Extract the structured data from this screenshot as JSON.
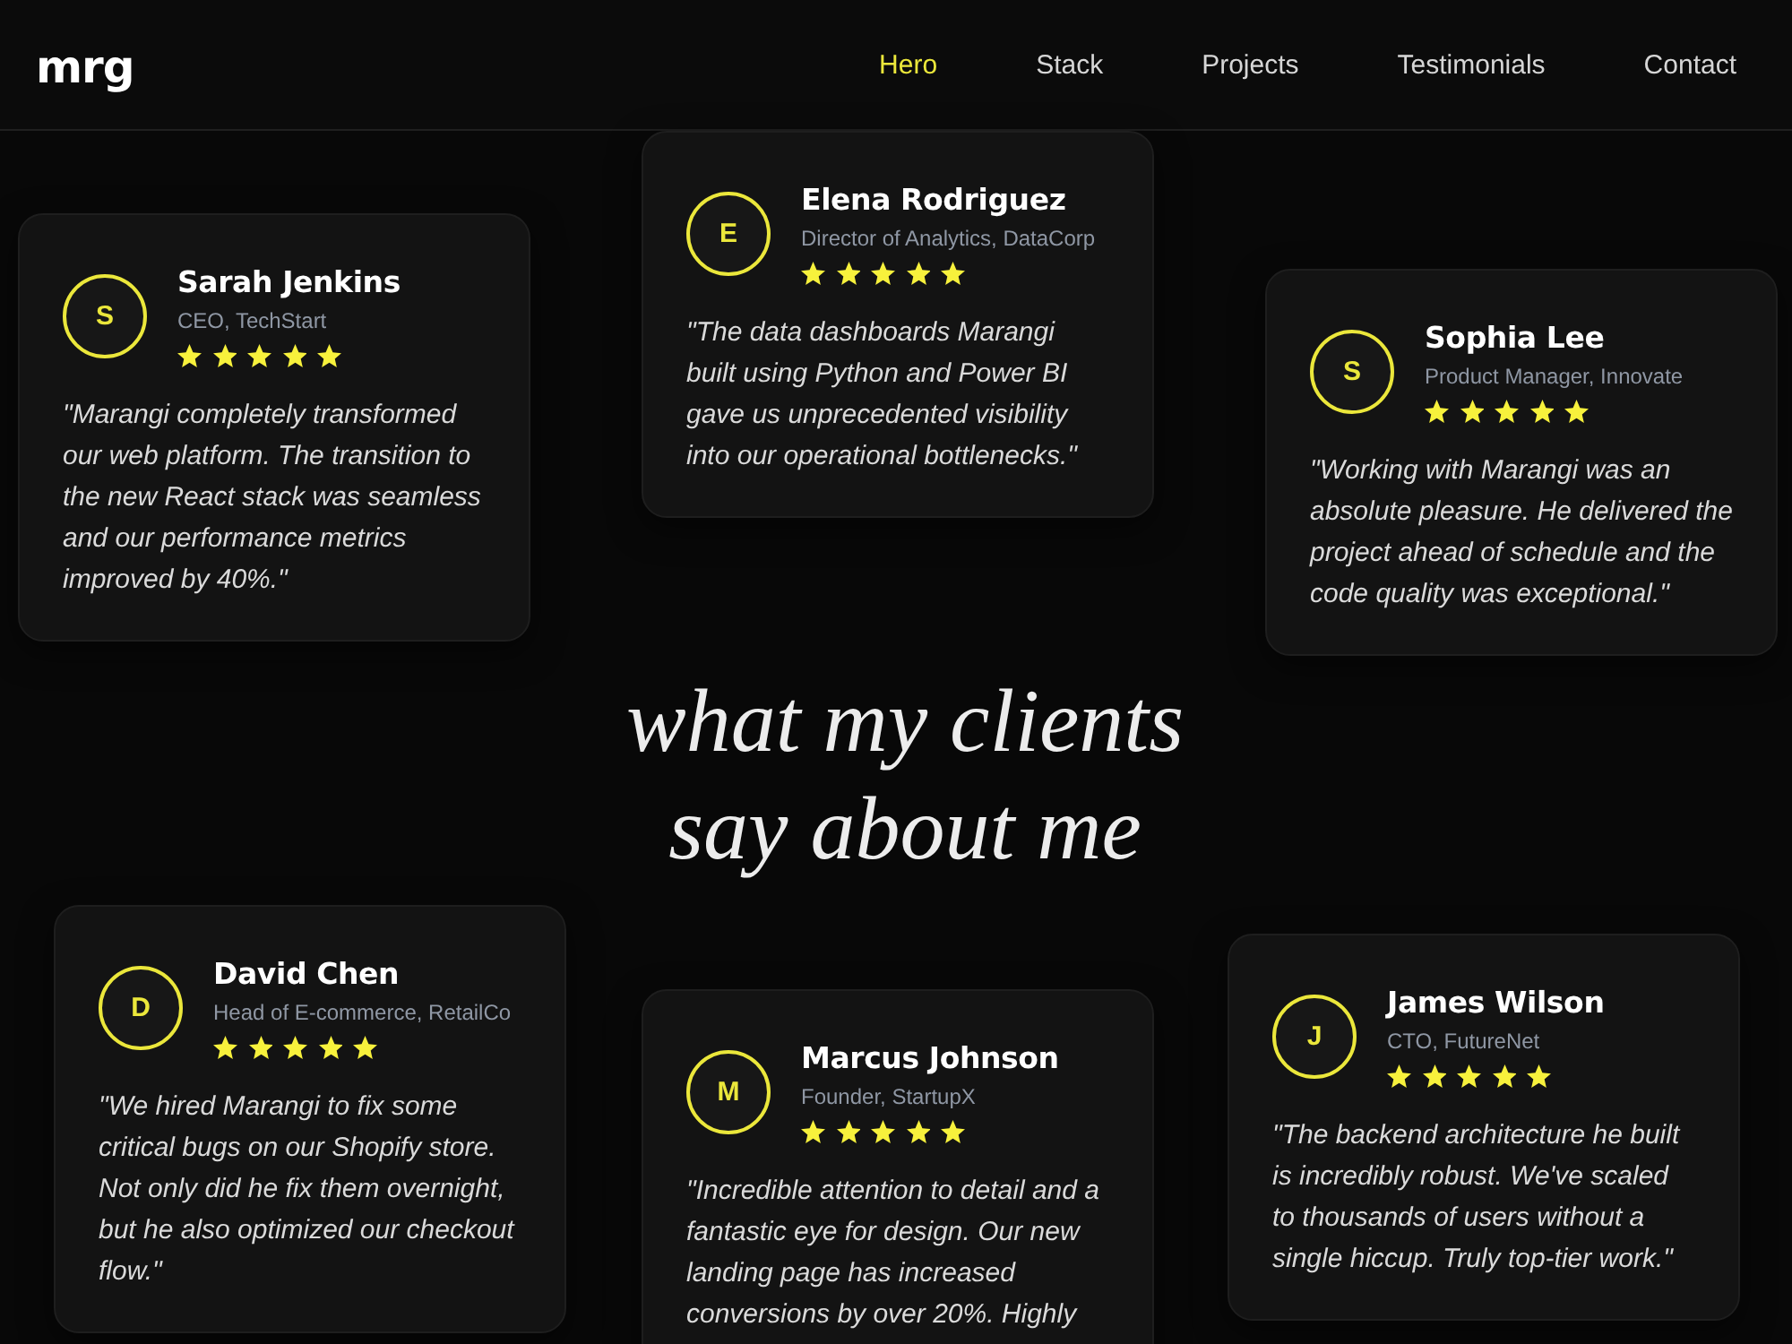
{
  "header": {
    "logo": "mrg",
    "nav": [
      {
        "label": "Hero",
        "selected": true
      },
      {
        "label": "Stack",
        "selected": false
      },
      {
        "label": "Projects",
        "selected": false
      },
      {
        "label": "Testimonials",
        "selected": false
      },
      {
        "label": "Contact",
        "selected": false
      }
    ]
  },
  "section": {
    "heading": "what my clients say about me",
    "testimonials": [
      {
        "initial": "S",
        "name": "Sarah Jenkins",
        "role": "CEO, TechStart",
        "stars": 5,
        "quote": "\"Marangi completely transformed our web platform. The transition to the new React stack was seamless and our performance metrics improved by 40%.\""
      },
      {
        "initial": "E",
        "name": "Elena Rodriguez",
        "role": "Director of Analytics, DataCorp",
        "stars": 5,
        "quote": "\"The data dashboards Marangi built using Python and Power BI gave us unprecedented visibility into our operational bottlenecks.\""
      },
      {
        "initial": "S",
        "name": "Sophia Lee",
        "role": "Product Manager, Innovate",
        "stars": 5,
        "quote": "\"Working with Marangi was an absolute pleasure. He delivered the project ahead of schedule and the code quality was exceptional.\""
      },
      {
        "initial": "D",
        "name": "David Chen",
        "role": "Head of E-commerce, RetailCo",
        "stars": 5,
        "quote": "\"We hired Marangi to fix some critical bugs on our Shopify store. Not only did he fix them overnight, but he also optimized our checkout flow.\""
      },
      {
        "initial": "M",
        "name": "Marcus Johnson",
        "role": "Founder, StartupX",
        "stars": 5,
        "quote": "\"Incredible attention to detail and a fantastic eye for design. Our new landing page has increased conversions by over 20%. Highly"
      },
      {
        "initial": "J",
        "name": "James Wilson",
        "role": "CTO, FutureNet",
        "stars": 5,
        "quote": "\"The backend architecture he built is incredibly robust. We've scaled to thousands of users without a single hiccup. Truly top-tier work.\""
      }
    ]
  }
}
